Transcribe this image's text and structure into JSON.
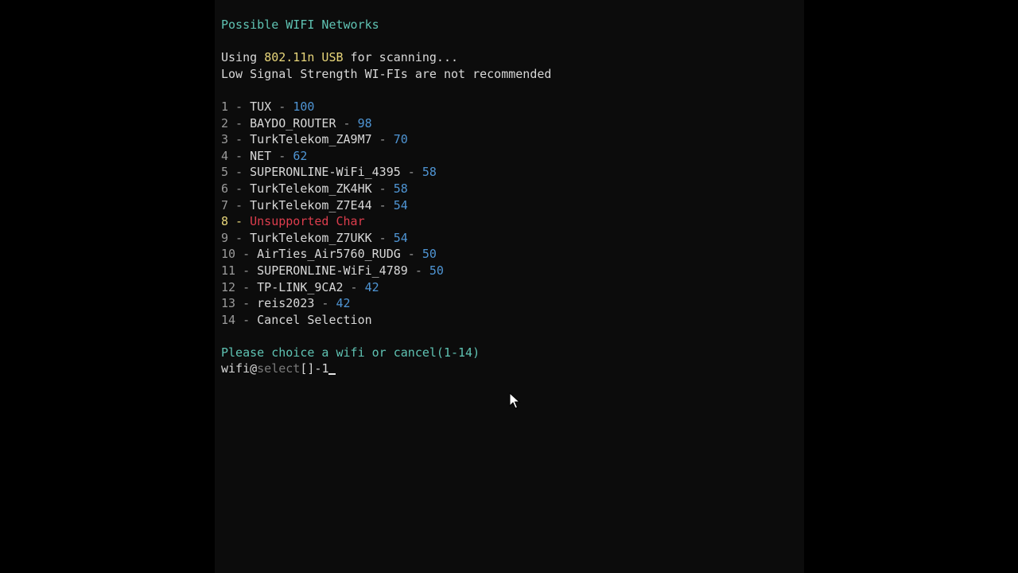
{
  "header": {
    "title": "Possible WIFI Networks",
    "using_prefix": "Using ",
    "adapter": "802.11n USB",
    "using_suffix": " for scanning...",
    "warning": "Low Signal Strength WI-FIs are not recommended"
  },
  "separator": " - ",
  "networks": [
    {
      "index": "1",
      "name": "TUX",
      "signal": "100"
    },
    {
      "index": "2",
      "name": "BAYDO_ROUTER",
      "signal": "98"
    },
    {
      "index": "3",
      "name": "TurkTelekom_ZA9M7",
      "signal": "70"
    },
    {
      "index": "4",
      "name": "NET",
      "signal": "62"
    },
    {
      "index": "5",
      "name": "SUPERONLINE-WiFi_4395",
      "signal": "58"
    },
    {
      "index": "6",
      "name": "TurkTelekom_ZK4HK",
      "signal": "58"
    },
    {
      "index": "7",
      "name": "TurkTelekom_Z7E44",
      "signal": "54"
    },
    {
      "index": "8",
      "name": "Unsupported Char",
      "signal": ""
    },
    {
      "index": "9",
      "name": "TurkTelekom_Z7UKK",
      "signal": "54"
    },
    {
      "index": "10",
      "name": "AirTies_Air5760_RUDG",
      "signal": "50"
    },
    {
      "index": "11",
      "name": "SUPERONLINE-WiFi_4789",
      "signal": "50"
    },
    {
      "index": "12",
      "name": "TP-LINK_9CA2",
      "signal": "42"
    },
    {
      "index": "13",
      "name": "reis2023",
      "signal": "42"
    },
    {
      "index": "14",
      "name": "Cancel Selection",
      "signal": ""
    }
  ],
  "prompt": {
    "question": "Please choice a wifi or cancel(1-14)",
    "user": "wifi@",
    "context": "select",
    "suffix": "[]-",
    "input_value": "1"
  },
  "colors": {
    "teal": "#5fc3b3",
    "gold": "#e8d67a",
    "signal_blue": "#4f95d4",
    "error_red": "#dd3d4d",
    "background": "#0c0c0c"
  },
  "icons": {
    "pointer": "mouse-pointer-icon"
  }
}
